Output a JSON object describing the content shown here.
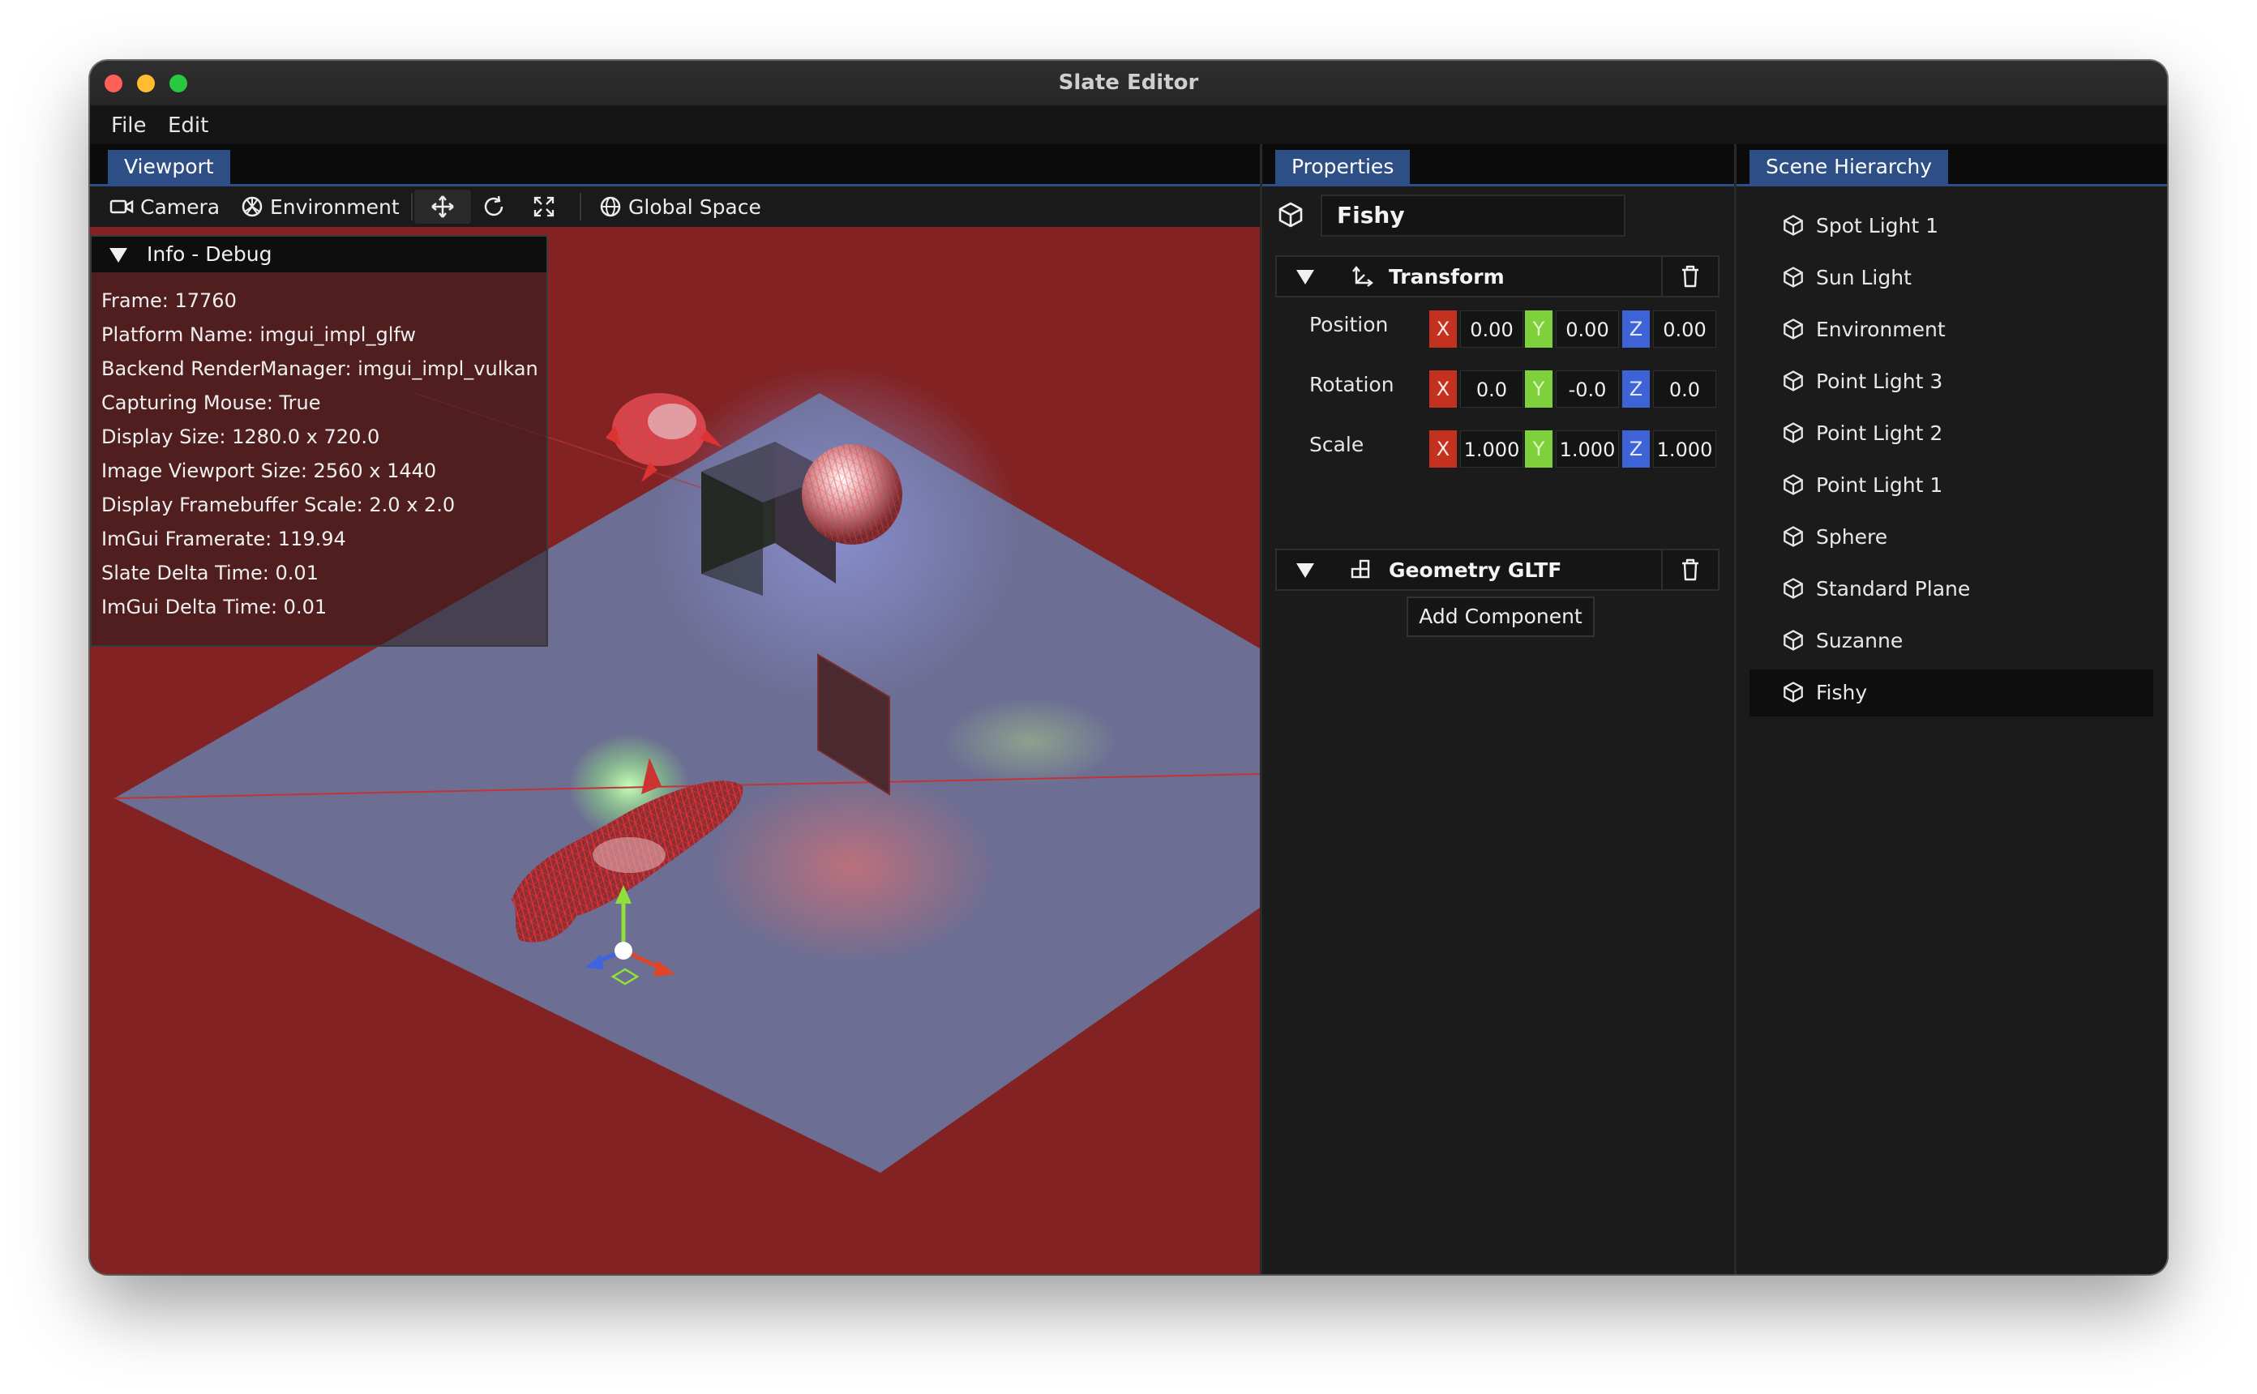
{
  "window": {
    "title": "Slate Editor"
  },
  "menu": {
    "items": [
      "File",
      "Edit"
    ]
  },
  "tabs": {
    "viewport": "Viewport",
    "properties": "Properties",
    "hierarchy": "Scene Hierarchy"
  },
  "toolbar": {
    "camera": "Camera",
    "environment": "Environment",
    "space": "Global Space",
    "icons": [
      "camera-icon",
      "environment-icon",
      "move-gizmo-icon",
      "rotate-gizmo-icon",
      "scale-gizmo-icon",
      "globe-icon"
    ]
  },
  "debug": {
    "title": "Info - Debug",
    "lines": [
      "Frame: 17760",
      "Platform Name: imgui_impl_glfw",
      "Backend RenderManager: imgui_impl_vulkan",
      "Capturing Mouse: True",
      "Display Size: 1280.0 x 720.0",
      "Image Viewport Size: 2560 x 1440",
      "Display Framebuffer Scale: 2.0 x 2.0",
      "ImGui Framerate: 119.94",
      "Slate Delta Time: 0.01",
      "ImGui Delta Time: 0.01"
    ]
  },
  "properties": {
    "entity_name": "Fishy",
    "transform": {
      "title": "Transform",
      "rows": [
        {
          "label": "Position",
          "x": "0.00",
          "y": "0.00",
          "z": "0.00"
        },
        {
          "label": "Rotation",
          "x": "0.0",
          "y": "-0.0",
          "z": "0.0"
        },
        {
          "label": "Scale",
          "x": "1.000",
          "y": "1.000",
          "z": "1.000"
        }
      ],
      "axis_labels": {
        "x": "X",
        "y": "Y",
        "z": "Z"
      }
    },
    "geometry": {
      "title": "Geometry GLTF"
    },
    "add_component": "Add Component"
  },
  "hierarchy": {
    "items": [
      "Spot Light 1",
      "Sun Light",
      "Environment",
      "Point Light 3",
      "Point Light 2",
      "Point Light 1",
      "Sphere",
      "Standard Plane",
      "Suzanne",
      "Fishy"
    ],
    "selected": "Fishy"
  },
  "colors": {
    "accent": "#2d4f86",
    "viewport_background": "#822222",
    "axis_x": "#c4321f",
    "axis_y": "#7fd13b",
    "axis_z": "#3d63d6"
  }
}
